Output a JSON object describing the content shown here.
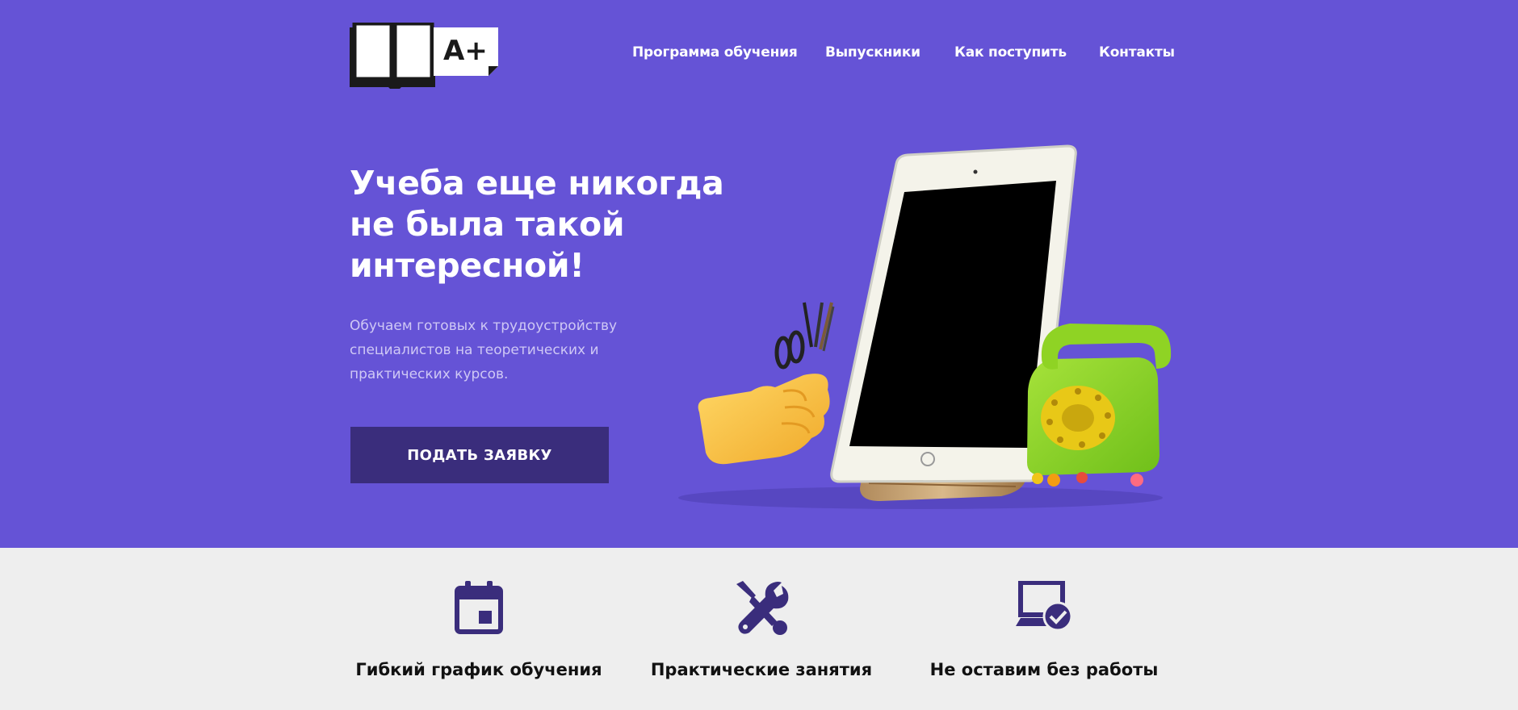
{
  "colors": {
    "hero_bg": "#6553d6",
    "button_bg": "#3a2d7c",
    "feature_icon": "#3a2d7c",
    "section_bg": "#eeeeee"
  },
  "logo": {
    "text": "A+"
  },
  "nav": {
    "items": [
      {
        "label": "Программа обучения"
      },
      {
        "label": "Выпускники"
      },
      {
        "label": "Как поступить"
      },
      {
        "label": "Контакты"
      }
    ]
  },
  "hero": {
    "title_lines": [
      "Учеба еще никогда",
      "не была такой",
      "интересной!"
    ],
    "description_lines": [
      "Обучаем готовых к трудоустройству",
      "специалистов на теоретических и",
      "практических курсов."
    ],
    "cta_label": "ПОДАТЬ ЗАЯВКУ"
  },
  "features": [
    {
      "icon": "calendar-icon",
      "title": "Гибкий график обучения"
    },
    {
      "icon": "tools-icon",
      "title": "Практические занятия"
    },
    {
      "icon": "laptop-check-icon",
      "title": "Не оставим без работы"
    }
  ]
}
